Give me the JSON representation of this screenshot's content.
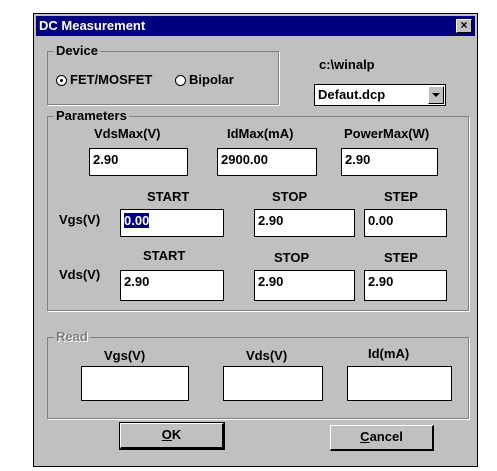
{
  "window": {
    "title": "DC Measurement",
    "close_glyph": "×"
  },
  "device": {
    "group_label": "Device",
    "fet_label": "FET/MOSFET",
    "bipolar_label": "Bipolar",
    "selected": "FET/MOSFET",
    "path_label": "c:\\winalp",
    "file_value": "Defaut.dcp"
  },
  "parameters": {
    "group_label": "Parameters",
    "vdsmax_label": "VdsMax(V)",
    "idmax_label": "IdMax(mA)",
    "powermax_label": "PowerMax(W)",
    "vdsmax_value": "2.90",
    "idmax_value": "2900.00",
    "powermax_value": "2.90",
    "vgs": {
      "row_label": "Vgs(V)",
      "start_label": "START",
      "stop_label": "STOP",
      "step_label": "STEP",
      "start_value": "0.00",
      "stop_value": "2.90",
      "step_value": "0.00"
    },
    "vds": {
      "row_label": "Vds(V)",
      "start_label": "START",
      "stop_label": "STOP",
      "step_label": "STEP",
      "start_value": "2.90",
      "stop_value": "2.90",
      "step_value": "2.90"
    }
  },
  "read": {
    "group_label": "Read",
    "vgs_label": "Vgs(V)",
    "vds_label": "Vds(V)",
    "id_label": "Id(mA)",
    "vgs_value": "",
    "vds_value": "",
    "id_value": ""
  },
  "buttons": {
    "ok_mnemonic": "O",
    "ok_rest": "K",
    "cancel_mnemonic": "C",
    "cancel_rest": "ancel"
  }
}
